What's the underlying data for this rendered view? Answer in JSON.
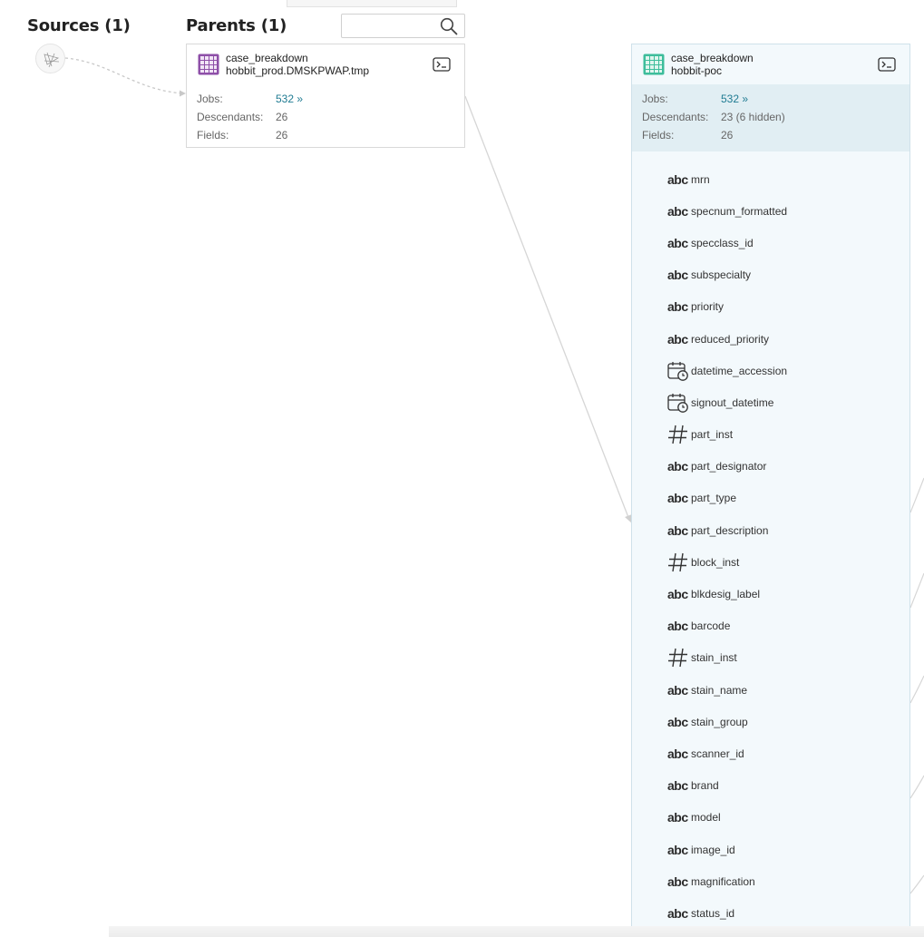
{
  "columns": {
    "sources_title": "Sources (1)",
    "parents_title": "Parents (1)"
  },
  "search": {
    "placeholder": "",
    "value": ""
  },
  "parent_dataset": {
    "name": "case_breakdown",
    "namespace": "hobbit_prod.DMSKPWAP.tmp",
    "icon": "table-grid-icon",
    "icon_color": "#8e4fa8",
    "stats": [
      {
        "label": "Jobs:",
        "value": "532 »",
        "is_link": true
      },
      {
        "label": "Descendants:",
        "value": "26",
        "is_link": false
      },
      {
        "label": "Fields:",
        "value": "26",
        "is_link": false
      }
    ]
  },
  "selected_dataset": {
    "name": "case_breakdown",
    "namespace": "hobbit-poc",
    "icon": "table-grid-icon",
    "icon_color": "#3dbd9b",
    "stats": [
      {
        "label": "Jobs:",
        "value": "532 »",
        "is_link": true
      },
      {
        "label": "Descendants:",
        "value": "23 (6 hidden)",
        "is_link": false
      },
      {
        "label": "Fields:",
        "value": "26",
        "is_link": false
      }
    ],
    "fields": [
      {
        "type": "abc",
        "name": "mrn"
      },
      {
        "type": "abc",
        "name": "specnum_formatted"
      },
      {
        "type": "abc",
        "name": "specclass_id"
      },
      {
        "type": "abc",
        "name": "subspecialty"
      },
      {
        "type": "abc",
        "name": "priority"
      },
      {
        "type": "abc",
        "name": "reduced_priority"
      },
      {
        "type": "datetime",
        "name": "datetime_accession"
      },
      {
        "type": "datetime",
        "name": "signout_datetime"
      },
      {
        "type": "number",
        "name": "part_inst"
      },
      {
        "type": "abc",
        "name": "part_designator"
      },
      {
        "type": "abc",
        "name": "part_type"
      },
      {
        "type": "abc",
        "name": "part_description"
      },
      {
        "type": "number",
        "name": "block_inst"
      },
      {
        "type": "abc",
        "name": "blkdesig_label"
      },
      {
        "type": "abc",
        "name": "barcode"
      },
      {
        "type": "number",
        "name": "stain_inst"
      },
      {
        "type": "abc",
        "name": "stain_name"
      },
      {
        "type": "abc",
        "name": "stain_group"
      },
      {
        "type": "abc",
        "name": "scanner_id"
      },
      {
        "type": "abc",
        "name": "brand"
      },
      {
        "type": "abc",
        "name": "model"
      },
      {
        "type": "abc",
        "name": "image_id"
      },
      {
        "type": "abc",
        "name": "magnification"
      },
      {
        "type": "abc",
        "name": "status_id"
      }
    ]
  },
  "colors": {
    "link": "#1f7b92",
    "edge": "#d0d0d0",
    "selected_bg": "#f3f9fc",
    "selected_stats_bg": "#e1eef3"
  }
}
